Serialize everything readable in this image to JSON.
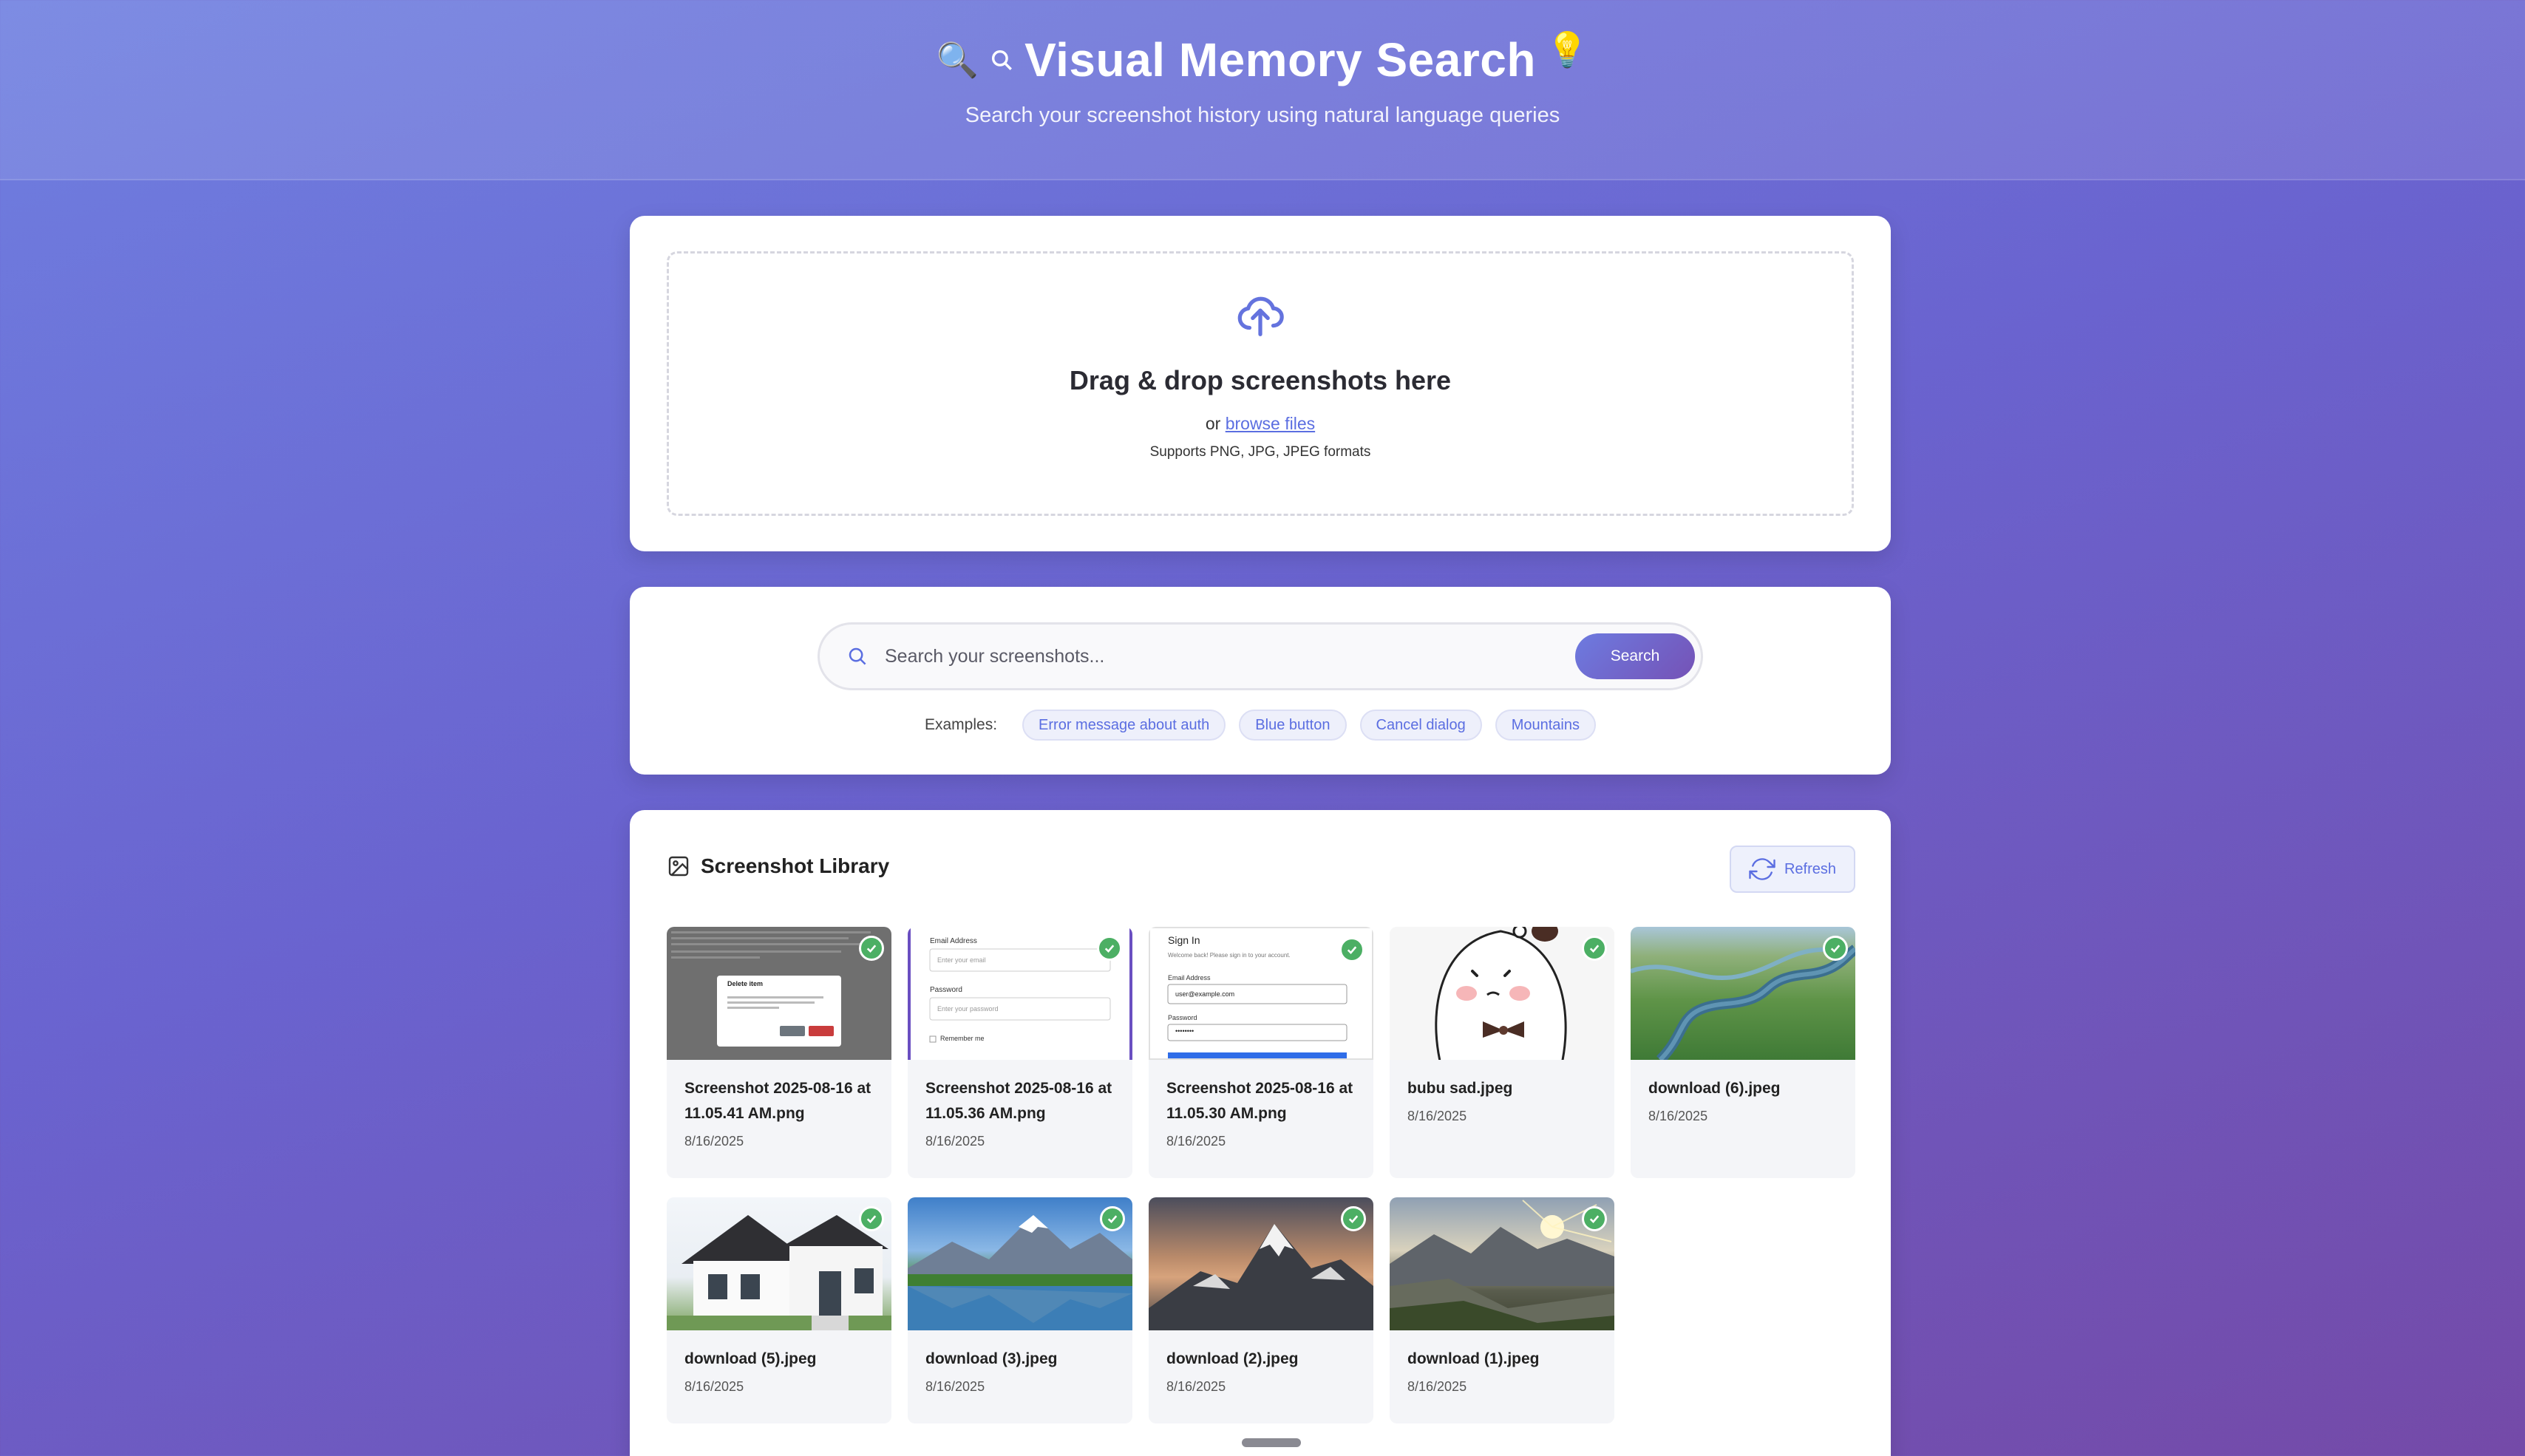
{
  "header": {
    "emoji_left_1": "🔍",
    "emoji_left_2": "🔍",
    "title": "Visual Memory Search",
    "emoji_right": "💡",
    "subtitle": "Search your screenshot history using natural language queries"
  },
  "upload": {
    "title": "Drag & drop screenshots here",
    "or_text": "or ",
    "browse_link": "browse files",
    "formats": "Supports PNG, JPG, JPEG formats"
  },
  "search": {
    "placeholder": "Search your screenshots...",
    "button_label": "Search",
    "examples_label": "Examples:",
    "examples": [
      "Error message about auth",
      "Blue button",
      "Cancel dialog",
      "Mountains"
    ]
  },
  "library": {
    "title": "Screenshot Library",
    "refresh_label": "Refresh",
    "items": [
      {
        "name": "Screenshot 2025-08-16 at 11.05.41 AM.png",
        "date": "8/16/2025",
        "thumb": "dialog",
        "status": "processed"
      },
      {
        "name": "Screenshot 2025-08-16 at 11.05.36 AM.png",
        "date": "8/16/2025",
        "thumb": "form",
        "status": "processed"
      },
      {
        "name": "Screenshot 2025-08-16 at 11.05.30 AM.png",
        "date": "8/16/2025",
        "thumb": "signin",
        "status": "processed"
      },
      {
        "name": "bubu sad.jpeg",
        "date": "8/16/2025",
        "thumb": "bear",
        "status": "processed"
      },
      {
        "name": "download (6).jpeg",
        "date": "8/16/2025",
        "thumb": "river",
        "status": "processed"
      },
      {
        "name": "download (5).jpeg",
        "date": "8/16/2025",
        "thumb": "house",
        "status": "processed"
      },
      {
        "name": "download (3).jpeg",
        "date": "8/16/2025",
        "thumb": "lake",
        "status": "processed"
      },
      {
        "name": "download (2).jpeg",
        "date": "8/16/2025",
        "thumb": "everest",
        "status": "processed"
      },
      {
        "name": "download (1).jpeg",
        "date": "8/16/2025",
        "thumb": "sunset",
        "status": "processed"
      }
    ]
  },
  "thumb_text": {
    "dialog_title": "Delete item",
    "form_email_label": "Email Address",
    "form_email_placeholder": "Enter your email",
    "form_password_label": "Password",
    "form_password_placeholder": "Enter your password",
    "form_remember": "Remember me",
    "signin_title": "Sign In",
    "signin_subtitle": "Welcome back! Please sign in to your account.",
    "signin_email_label": "Email Address",
    "signin_email_value": "user@example.com",
    "signin_password_label": "Password",
    "signin_password_value": "••••••••"
  },
  "colors": {
    "accent": "#5b6ee1",
    "check": "#4caf64"
  }
}
